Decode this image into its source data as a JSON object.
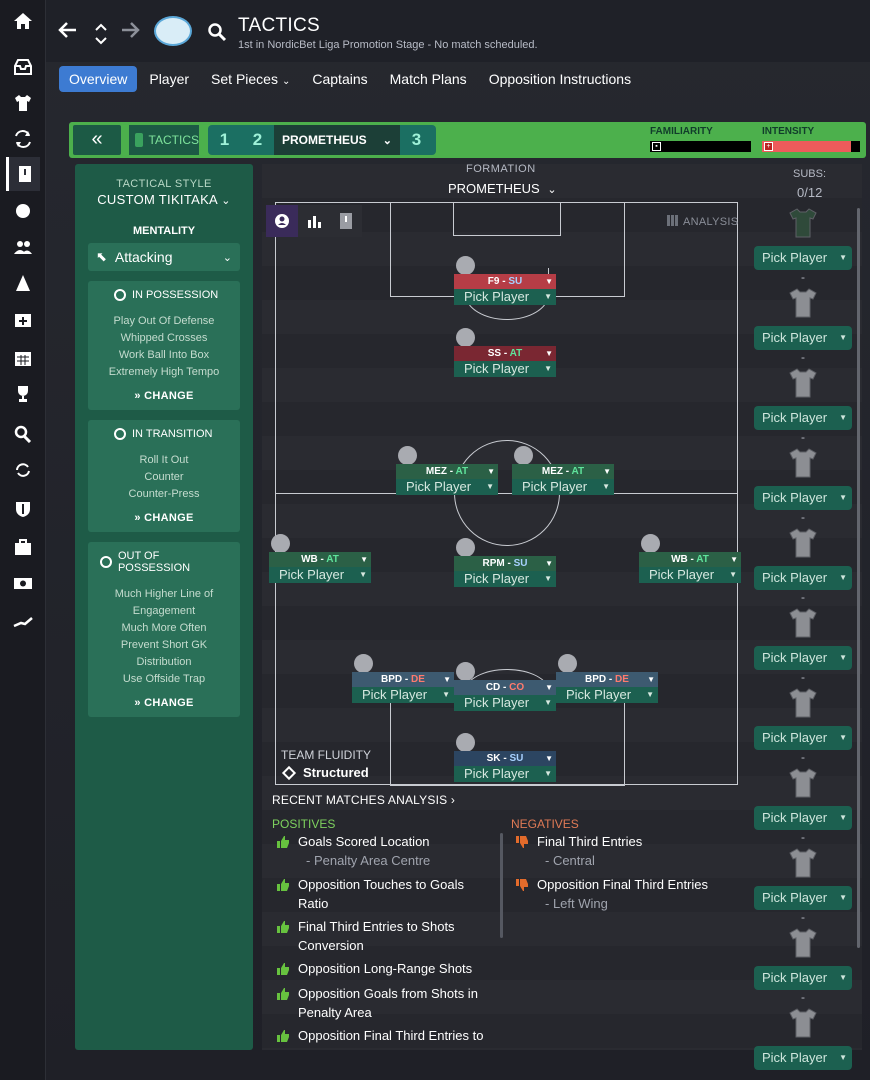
{
  "header": {
    "title": "TACTICS",
    "subtitle": "1st in NordicBet Liga Promotion Stage - No match scheduled."
  },
  "tabs": [
    {
      "label": "Overview"
    },
    {
      "label": "Player"
    },
    {
      "label": "Set Pieces"
    },
    {
      "label": "Captains"
    },
    {
      "label": "Match Plans"
    },
    {
      "label": "Opposition Instructions"
    }
  ],
  "tactic_bar": {
    "back_icon": "«",
    "tactics_label": "TACTICS",
    "slot1": "1",
    "slot2": "2",
    "selected_name": "PROMETHEUS",
    "slot3": "3",
    "familiarity_label": "FAMILIARITY",
    "intensity_label": "INTENSITY",
    "familiarity_level": 0.0,
    "intensity_level": 0.91,
    "accent": "#4cb04c"
  },
  "left_panel": {
    "style_title": "TACTICAL STYLE",
    "style_value": "CUSTOM TIKITAKA",
    "mentality_title": "MENTALITY",
    "mentality_value": "Attacking",
    "in_possession": {
      "title": "IN POSSESSION",
      "items": [
        "Play Out Of Defense",
        "Whipped Crosses",
        "Work Ball Into Box",
        "Extremely High Tempo"
      ],
      "change": "CHANGE"
    },
    "in_transition": {
      "title": "IN TRANSITION",
      "items": [
        "Roll It Out",
        "Counter",
        "Counter-Press"
      ],
      "change": "CHANGE"
    },
    "out_of_possession": {
      "title": "OUT OF POSSESSION",
      "items": [
        "Much Higher Line of",
        "Engagement",
        "Much More Often",
        "Prevent Short GK",
        "Distribution",
        "Use Offside Trap"
      ],
      "change": "CHANGE"
    }
  },
  "formation": {
    "label": "FORMATION",
    "value": "PROMETHEUS",
    "analysis": "ANALYSIS",
    "subs_label": "SUBS:",
    "subs_count": "0/12",
    "fluidity_label": "TEAM FLUIDITY",
    "fluidity_value": "Structured"
  },
  "players": [
    {
      "role": "F9",
      "duty": "SU",
      "pick": "Pick Player"
    },
    {
      "role": "SS",
      "duty": "AT",
      "pick": "Pick Player"
    },
    {
      "role": "MEZ",
      "duty": "AT",
      "pick": "Pick Player"
    },
    {
      "role": "MEZ",
      "duty": "AT",
      "pick": "Pick Player"
    },
    {
      "role": "WB",
      "duty": "AT",
      "pick": "Pick Player"
    },
    {
      "role": "RPM",
      "duty": "SU",
      "pick": "Pick Player"
    },
    {
      "role": "WB",
      "duty": "AT",
      "pick": "Pick Player"
    },
    {
      "role": "BPD",
      "duty": "DE",
      "pick": "Pick Player"
    },
    {
      "role": "CD",
      "duty": "CO",
      "pick": "Pick Player"
    },
    {
      "role": "BPD",
      "duty": "DE",
      "pick": "Pick Player"
    },
    {
      "role": "SK",
      "duty": "SU",
      "pick": "Pick Player"
    }
  ],
  "subs": {
    "pick": "Pick Player",
    "dash": "-",
    "last_pick": "Pick Player"
  },
  "recent": {
    "title": "RECENT MATCHES ANALYSIS",
    "positives_label": "POSITIVES",
    "negatives_label": "NEGATIVES",
    "positives": [
      {
        "text": "Goals Scored Location",
        "sub": "- Penalty Area Centre"
      },
      {
        "text": "Opposition Touches to Goals",
        "text2": "Ratio"
      },
      {
        "text": "Final Third Entries to Shots",
        "text2": "Conversion"
      },
      {
        "text": "Opposition Long-Range Shots"
      },
      {
        "text": "Opposition Goals from Shots in",
        "text2": "Penalty Area"
      },
      {
        "text": "Opposition Final Third Entries to"
      }
    ],
    "negatives": [
      {
        "text": "Final Third Entries",
        "sub": "- Central"
      },
      {
        "text": "Opposition Final Third Entries",
        "sub": "- Left Wing"
      }
    ]
  }
}
